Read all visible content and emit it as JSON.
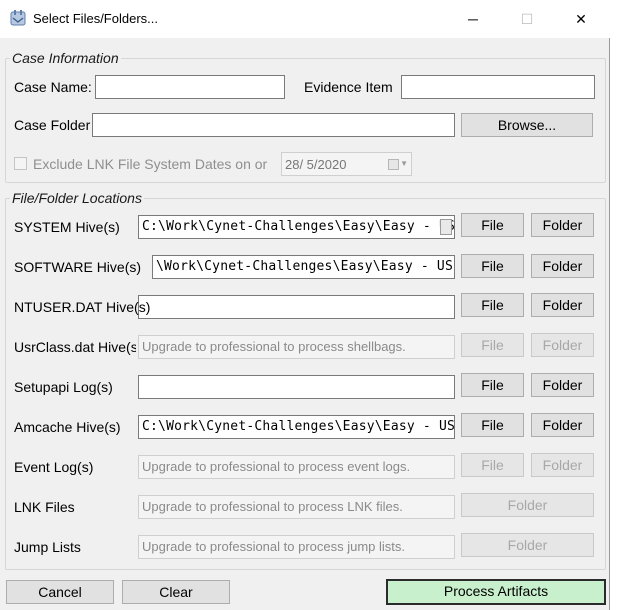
{
  "window": {
    "title": "Select Files/Folders...",
    "icon": "app-icon",
    "controls": {
      "minimize": "─",
      "maximize": "☐",
      "close": "✕"
    }
  },
  "case_info": {
    "legend": "Case Information",
    "case_name_label": "Case Name:",
    "case_name_value": "",
    "evidence_item_label": "Evidence Item",
    "evidence_item_value": "",
    "case_folder_label": "Case Folder",
    "case_folder_value": "",
    "browse_label": "Browse...",
    "exclude_lnk_label": "Exclude LNK File System Dates on or",
    "exclude_lnk_checked": false,
    "date_value": "28/  5/2020"
  },
  "locations": {
    "legend": "File/Folder Locations",
    "file_label": "File",
    "folder_label": "Folder",
    "rows": [
      {
        "label": "SYSTEM Hive(s)",
        "value": "C:\\Work\\Cynet-Challenges\\Easy\\Easy - USB Device\\"
      },
      {
        "label": "SOFTWARE Hive(s)",
        "value": "\\Work\\Cynet-Challenges\\Easy\\Easy - USB Dev"
      },
      {
        "label": "NTUSER.DAT Hive(s)",
        "value": ""
      },
      {
        "label": "UsrClass.dat Hive(s)",
        "value": "Upgrade to professional to process shellbags."
      },
      {
        "label": "Setupapi Log(s)",
        "value": ""
      },
      {
        "label": "Amcache Hive(s)",
        "value": "C:\\Work\\Cynet-Challenges\\Easy\\Easy - USB Device\\"
      },
      {
        "label": "Event Log(s)",
        "value": "Upgrade to professional to process event logs."
      },
      {
        "label": "LNK Files",
        "value": "Upgrade to professional to process LNK files."
      },
      {
        "label": "Jump Lists",
        "value": "Upgrade to professional to process jump lists."
      }
    ]
  },
  "footer": {
    "cancel_label": "Cancel",
    "clear_label": "Clear",
    "process_label": "Process Artifacts",
    "process_color": "#c8f0cc"
  }
}
